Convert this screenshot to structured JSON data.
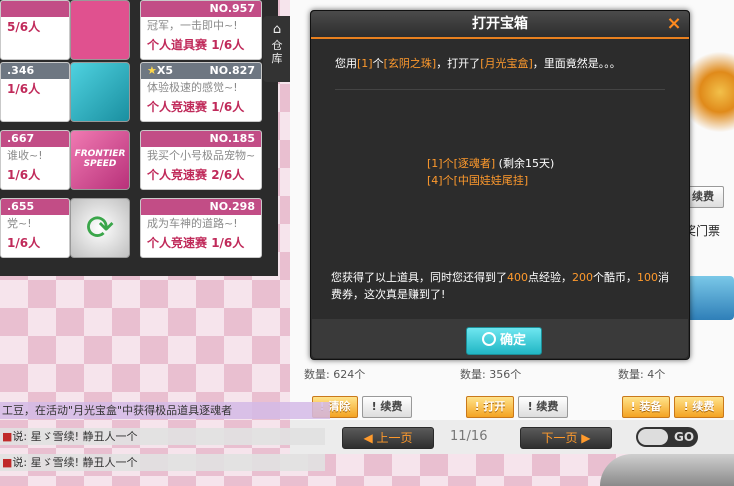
{
  "rooms": [
    {
      "id": "",
      "title": "",
      "mode": "",
      "count": "5/6人",
      "style": "pink"
    },
    {
      "id": "NO.957",
      "title": "冠军，一击即中~!",
      "mode": "个人道具赛",
      "count": "1/6人",
      "style": "pink"
    },
    {
      "id": ".346",
      "title": "",
      "mode": "",
      "count": "1/6人",
      "style": "dark"
    },
    {
      "id": "NO.827",
      "prefix": "X5",
      "title": "体验极速的感觉~!",
      "mode": "个人竞速赛",
      "count": "1/6人",
      "style": "pink"
    },
    {
      "id": ".667",
      "title": "谁收~!",
      "mode": "",
      "count": "1/6人",
      "style": "pink"
    },
    {
      "id": "NO.185",
      "title": "我买个小号极品宠物~",
      "mode": "个人竞速赛",
      "count": "2/6人",
      "style": "pink"
    },
    {
      "id": ".655",
      "title": "党~!",
      "mode": "",
      "count": "1/6人",
      "style": "pink"
    },
    {
      "id": "NO.298",
      "title": "成为车神的道路~!",
      "mode": "个人竞速赛",
      "count": "1/6人",
      "style": "pink"
    }
  ],
  "thumbs": [
    "room-thumb-pink",
    "room-thumb-teal",
    "room-thumb-frontier",
    "room-thumb-arrow"
  ],
  "frontier_text": "FRONTIER SPEED",
  "sidetab": {
    "label": "仓库"
  },
  "warehouse": {
    "renew_label": "续费",
    "ticket_label": "奖门票",
    "qty1": "数量: 624个",
    "qty2": "数量: 356个",
    "qty3": "数量: 4个",
    "clear_btn": "清除",
    "open_btn": "打开",
    "equip_btn": "装备",
    "renew_btn": "续费"
  },
  "pager": {
    "prev": "上一页",
    "page": "11/16",
    "next": "下一页",
    "go": "GO"
  },
  "chat": [
    {
      "text": "工豆，在活动\"月光宝盒\"中获得极品道具逐魂者"
    },
    {
      "text": "说: 星ゞ雪续! 静丑人一个"
    },
    {
      "text": "说: 星ゞ雪续! 静丑人一个"
    }
  ],
  "modal": {
    "title": "打开宝箱",
    "close": "×",
    "intro": {
      "a": "您用",
      "b": "[1]",
      "c": "个",
      "d": "[玄阴之珠]",
      "e": "，打开了",
      "f": "[月光宝盒]",
      "g": "，里面竟然是。。。"
    },
    "items": [
      "[1]个[逐魂者]",
      "[4]个[中国娃娃尾挂]"
    ],
    "item1_suffix": "(剩余15天)",
    "result": {
      "a": "您获得了以上道具，同时您还得到了",
      "b": "400",
      "c": "点经验，",
      "d": "200",
      "e": "个酷币，",
      "f": "100",
      "g": "消费券，这次真是赚到了!"
    },
    "confirm": "确定"
  },
  "colors": {
    "accent": "#e8801f",
    "highlight": "#ff9a2c",
    "confirm": "#21b6c4"
  }
}
